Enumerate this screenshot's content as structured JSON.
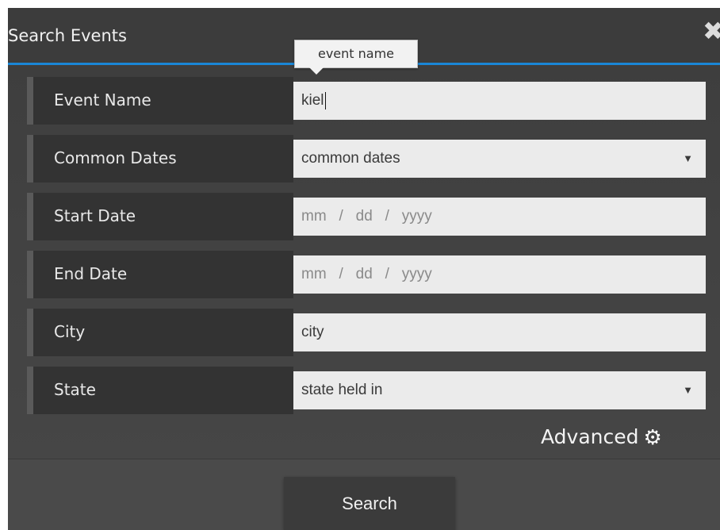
{
  "dialog": {
    "title": "Search Events",
    "close_glyph": "✖",
    "tooltip": "event name"
  },
  "fields": {
    "event_name": {
      "label": "Event Name",
      "value": "kiel"
    },
    "common_dates": {
      "label": "Common Dates",
      "value": "common dates",
      "arrow": "▼"
    },
    "start_date": {
      "label": "Start Date",
      "mm": "mm",
      "sep": "/",
      "dd": "dd",
      "yyyy": "yyyy"
    },
    "end_date": {
      "label": "End Date",
      "mm": "mm",
      "sep": "/",
      "dd": "dd",
      "yyyy": "yyyy"
    },
    "city": {
      "label": "City",
      "value": "city"
    },
    "state": {
      "label": "State",
      "value": "state held in",
      "arrow": "▼"
    }
  },
  "advanced": {
    "label": "Advanced",
    "icon": "gear-icon",
    "glyph": "⚙"
  },
  "footer": {
    "search_label": "Search"
  },
  "colors": {
    "accent": "#1a86d6"
  }
}
